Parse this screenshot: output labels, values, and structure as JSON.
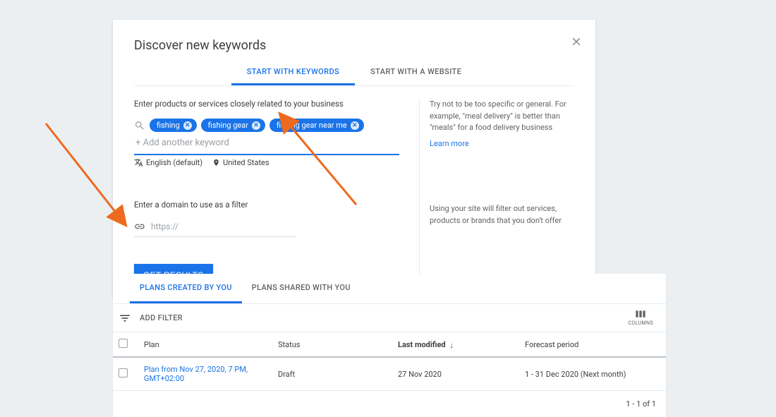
{
  "dialog": {
    "title": "Discover new keywords",
    "tabs": {
      "keywords": "START WITH KEYWORDS",
      "website": "START WITH A WEBSITE"
    },
    "keyword_section": {
      "label": "Enter products or services closely related to your business",
      "chips": [
        "fishing",
        "fishing gear",
        "fishing gear near me"
      ],
      "placeholder": "+ Add another keyword",
      "language": "English (default)",
      "location": "United States",
      "tip": "Try not to be too specific or general. For example, \"meal delivery\" is better than \"meals\" for a food delivery business",
      "learn_more": "Learn more"
    },
    "domain_section": {
      "label": "Enter a domain to use as a filter",
      "placeholder": "https://",
      "tip": "Using your site will filter out services, products or brands that you don't offer"
    },
    "get_results": "GET RESULTS"
  },
  "plans": {
    "tabs": {
      "mine": "PLANS CREATED BY YOU",
      "shared": "PLANS SHARED WITH YOU"
    },
    "add_filter": "ADD FILTER",
    "columns": "COLUMNS",
    "headers": {
      "plan": "Plan",
      "status": "Status",
      "last_modified": "Last modified",
      "forecast": "Forecast period"
    },
    "rows": [
      {
        "plan": "Plan from Nov 27, 2020, 7 PM, GMT+02:00",
        "status": "Draft",
        "last_modified": "27 Nov 2020",
        "forecast": "1 - 31 Dec 2020 (Next month)"
      }
    ],
    "pagination": "1 - 1 of 1"
  }
}
